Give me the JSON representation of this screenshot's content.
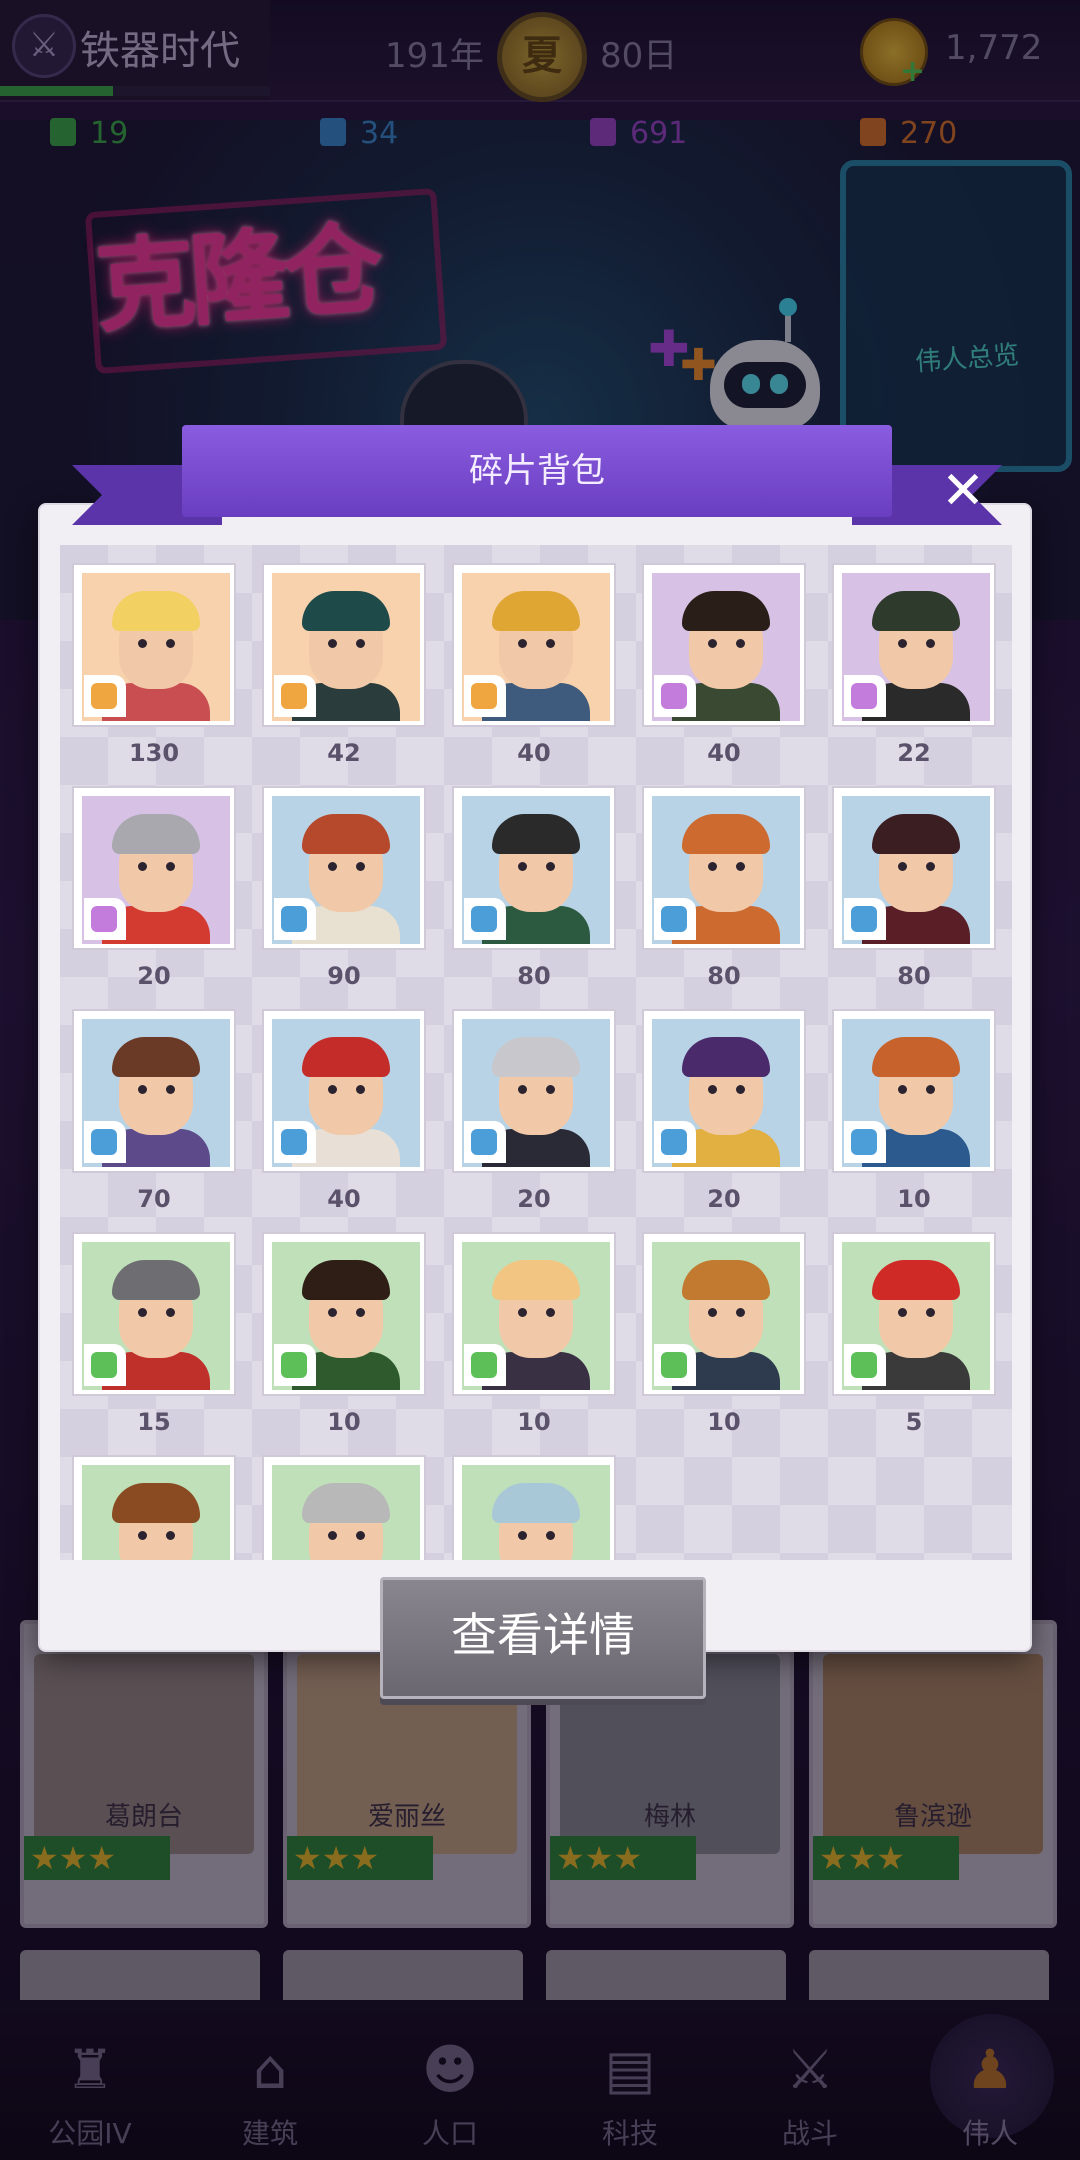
{
  "hud": {
    "era_name": "铁器时代",
    "era_progress": 0.42,
    "year": "191年",
    "season": "夏",
    "day": "80日",
    "coins": "1,772"
  },
  "resources": [
    {
      "value": "19",
      "color": "#3bb34a"
    },
    {
      "value": "34",
      "color": "#3a8ed8"
    },
    {
      "value": "691",
      "color": "#a04ad0"
    },
    {
      "value": "270",
      "color": "#e07828"
    }
  ],
  "scene": {
    "sign": "克隆仓",
    "panel_label": "伟人总览"
  },
  "modal": {
    "title": "碎片背包",
    "close": "✕",
    "detail_button": "查看详情"
  },
  "fragments": [
    {
      "count": "130",
      "bg": "#f7d2ad",
      "rarity": "#f0a640",
      "hair": "#f2d062",
      "body": "#c84e52"
    },
    {
      "count": "42",
      "bg": "#f7d2ad",
      "rarity": "#f0a640",
      "hair": "#1f4a4a",
      "body": "#2b3c3c"
    },
    {
      "count": "40",
      "bg": "#f7d2ad",
      "rarity": "#f0a640",
      "hair": "#e0a634",
      "body": "#3e5a7c"
    },
    {
      "count": "40",
      "bg": "#d7c2e6",
      "rarity": "#c47cdc",
      "hair": "#2a1e18",
      "body": "#3a4a32"
    },
    {
      "count": "22",
      "bg": "#d7c2e6",
      "rarity": "#c47cdc",
      "hair": "#2e3a2c",
      "body": "#2a2a2a"
    },
    {
      "count": "20",
      "bg": "#d7c2e6",
      "rarity": "#c47cdc",
      "hair": "#a8a8ae",
      "body": "#d33a30"
    },
    {
      "count": "90",
      "bg": "#b8d2e6",
      "rarity": "#4c9ed8",
      "hair": "#b6482c",
      "body": "#e8e0d0"
    },
    {
      "count": "80",
      "bg": "#b8d2e6",
      "rarity": "#4c9ed8",
      "hair": "#2a2a2a",
      "body": "#2c5a40"
    },
    {
      "count": "80",
      "bg": "#b8d2e6",
      "rarity": "#4c9ed8",
      "hair": "#cc6a30",
      "body": "#cc6a30"
    },
    {
      "count": "80",
      "bg": "#b8d2e6",
      "rarity": "#4c9ed8",
      "hair": "#3a1e22",
      "body": "#5a1e26"
    },
    {
      "count": "70",
      "bg": "#b8d2e6",
      "rarity": "#4c9ed8",
      "hair": "#6a3a26",
      "body": "#5c4a8a"
    },
    {
      "count": "40",
      "bg": "#b8d2e6",
      "rarity": "#4c9ed8",
      "hair": "#c42c2a",
      "body": "#e8e0d6"
    },
    {
      "count": "20",
      "bg": "#b8d2e6",
      "rarity": "#4c9ed8",
      "hair": "#c8c8cc",
      "body": "#2a2a36"
    },
    {
      "count": "20",
      "bg": "#b8d2e6",
      "rarity": "#4c9ed8",
      "hair": "#4a2a6a",
      "body": "#e2b040"
    },
    {
      "count": "10",
      "bg": "#b8d2e6",
      "rarity": "#4c9ed8",
      "hair": "#c8622c",
      "body": "#2c5a8e"
    },
    {
      "count": "15",
      "bg": "#bfe0b8",
      "rarity": "#5cbf58",
      "hair": "#6e6e72",
      "body": "#c0302a"
    },
    {
      "count": "10",
      "bg": "#bfe0b8",
      "rarity": "#5cbf58",
      "hair": "#2e1e16",
      "body": "#2e5a2e"
    },
    {
      "count": "10",
      "bg": "#bfe0b8",
      "rarity": "#5cbf58",
      "hair": "#f2c682",
      "body": "#3a3044"
    },
    {
      "count": "10",
      "bg": "#bfe0b8",
      "rarity": "#5cbf58",
      "hair": "#c27a30",
      "body": "#2e3a4e"
    },
    {
      "count": "5",
      "bg": "#bfe0b8",
      "rarity": "#5cbf58",
      "hair": "#d02a26",
      "body": "#3a3a3a"
    },
    {
      "count": "",
      "bg": "#bfe0b8",
      "rarity": "#5cbf58",
      "hair": "#8a4a22",
      "body": "#4a3a2a"
    },
    {
      "count": "",
      "bg": "#bfe0b8",
      "rarity": "#5cbf58",
      "hair": "#b8b8b8",
      "body": "#4a4a4a"
    },
    {
      "count": "",
      "bg": "#bfe0b8",
      "rarity": "#5cbf58",
      "hair": "#a8c8d8",
      "body": "#3a4a5a"
    }
  ],
  "heroes": [
    {
      "name": "葛朗台",
      "stars": "★★★"
    },
    {
      "name": "爱丽丝",
      "stars": "★★★"
    },
    {
      "name": "梅林",
      "stars": "★★★"
    },
    {
      "name": "鲁滨逊",
      "stars": "★★★"
    }
  ],
  "nav": [
    {
      "label": "公园IV",
      "icon": "castle-icon",
      "glyph": "♜"
    },
    {
      "label": "建筑",
      "icon": "house-icon",
      "glyph": "⌂"
    },
    {
      "label": "人口",
      "icon": "person-icon",
      "glyph": "☻"
    },
    {
      "label": "科技",
      "icon": "book-icon",
      "glyph": "▤"
    },
    {
      "label": "战斗",
      "icon": "swords-icon",
      "glyph": "⚔"
    },
    {
      "label": "伟人",
      "icon": "statue-icon",
      "glyph": "♟"
    }
  ]
}
